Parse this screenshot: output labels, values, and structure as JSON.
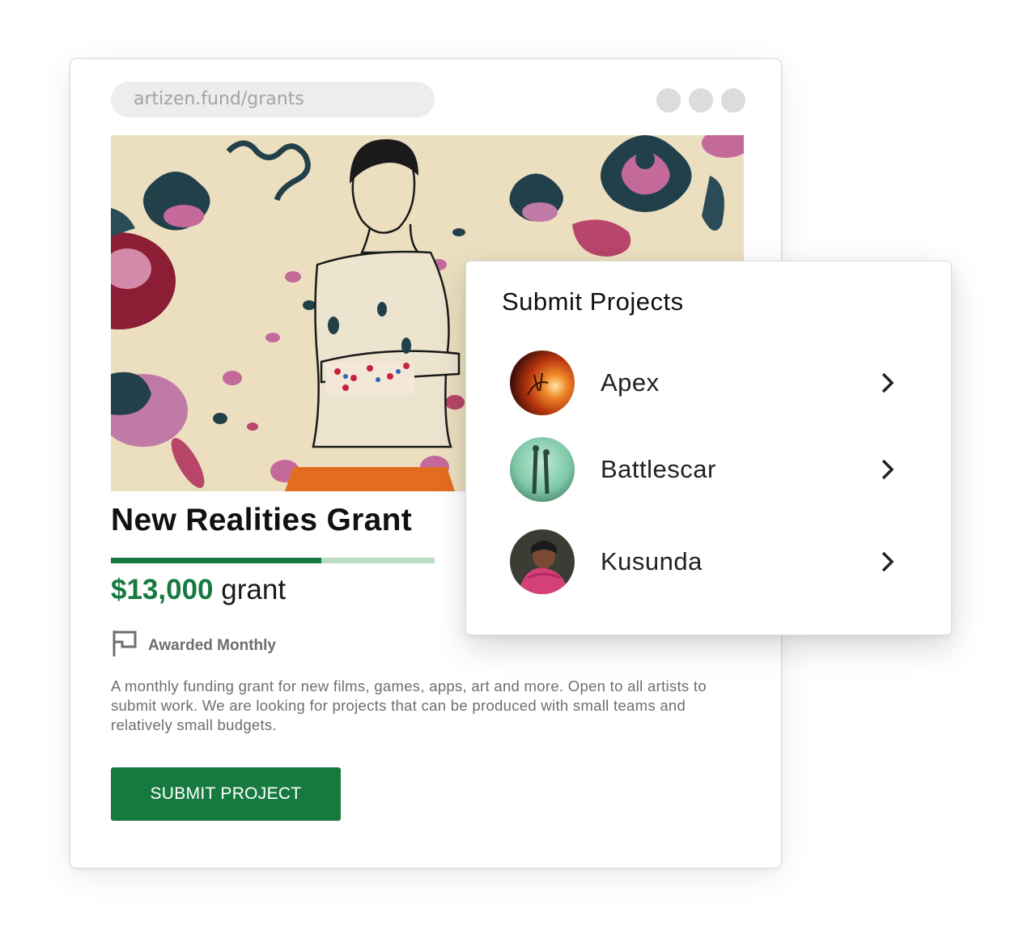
{
  "browser": {
    "url": "artizen.fund/grants"
  },
  "grant": {
    "title": "New Realities Grant",
    "funded_fraction": 0.65,
    "amount": "$13,000",
    "amount_suffix": "grant",
    "award_frequency": "Awarded Monthly",
    "description": "A monthly funding grant for new films, games, apps, art and more. Open to all artists to submit work. We are looking for projects that can be produced with small teams and relatively small budgets.",
    "submit_label": "SUBMIT PROJECT"
  },
  "popup": {
    "title": "Submit Projects",
    "projects": [
      {
        "name": "Apex",
        "icon": "chevron-right-icon"
      },
      {
        "name": "Battlescar",
        "icon": "chevron-right-icon"
      },
      {
        "name": "Kusunda",
        "icon": "chevron-right-icon"
      }
    ]
  },
  "colors": {
    "accent": "#167a40",
    "accent_light": "#b9dcc6",
    "hero_background": "#ecdfc0"
  }
}
